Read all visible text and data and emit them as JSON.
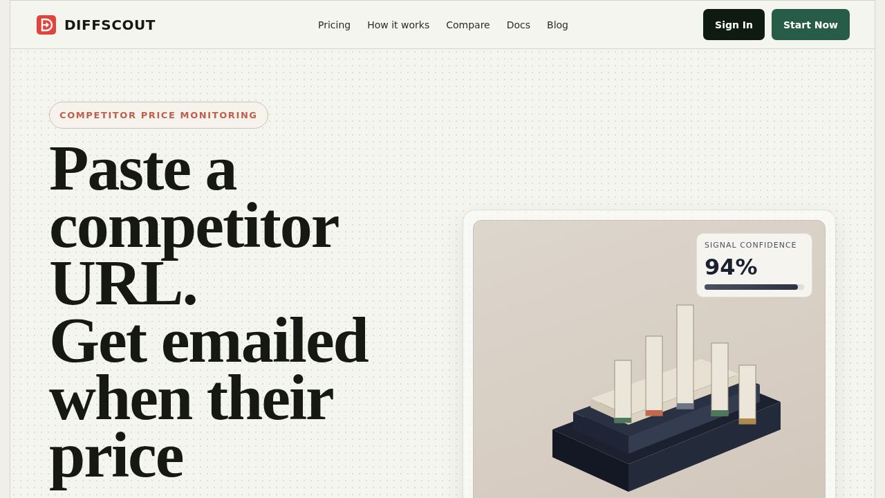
{
  "brand": {
    "name": "DIFFSCOUT"
  },
  "nav": [
    "Pricing",
    "How it works",
    "Compare",
    "Docs",
    "Blog"
  ],
  "actions": [
    {
      "label": "Sign In",
      "kind": "secondary"
    },
    {
      "label": "Start Now",
      "kind": "primary"
    }
  ],
  "hero": {
    "eyebrow": "COMPETITOR PRICE MONITORING",
    "headline_lines": [
      "Paste a",
      "competitor",
      "URL.",
      "Get emailed",
      "when their",
      "price"
    ]
  },
  "confidence_card": {
    "label": "SIGNAL CONFIDENCE",
    "value": "94%",
    "level": 0.94
  }
}
